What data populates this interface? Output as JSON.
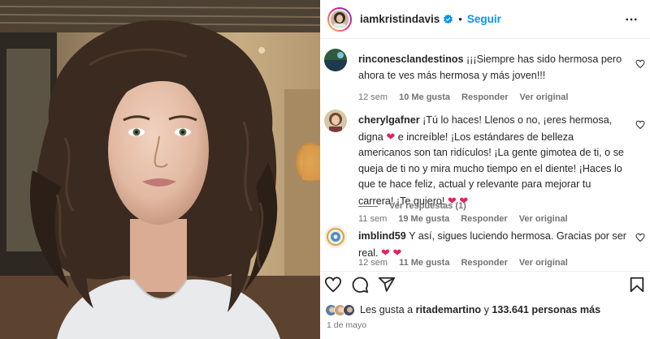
{
  "post": {
    "author": "iamkristindavis",
    "separator": "•",
    "follow_label": "Seguir",
    "date": "1 de mayo",
    "colors": {
      "accent": "#0095f6",
      "heart": "#e0245e",
      "muted": "#737373"
    }
  },
  "comments": [
    {
      "user": "rinconesclandestinos",
      "text": "¡¡¡Siempre has sido hermosa pero ahora te ves más hermosa y más joven!!!",
      "time": "12 sem",
      "likes": "10 Me gusta",
      "reply": "Responder",
      "translate": "Ver original"
    },
    {
      "user": "cherylgafner",
      "text_1": "¡Tú lo haces! Llenos o no, ¡eres hermosa, digna",
      "heart": "❤",
      "text_2": "e increíble! ¡Los estándares de belleza americanos son tan ridículos! ¡La gente gimotea de ti, o se queja de ti no y mira mucho tiempo en el diente! ¡Haces lo que te hace feliz, actual y relevante para mejorar tu carrera! ¡Te quiero!",
      "hearts_end": "❤ ❤",
      "time": "11 sem",
      "likes": "19 Me gusta",
      "reply": "Responder",
      "translate": "Ver original",
      "view_replies": "Ver respuestas (1)"
    },
    {
      "user": "imblind59",
      "text": "Y así, sigues luciendo hermosa. Gracias por ser real.",
      "hearts_end": "❤ ❤",
      "time": "12 sem",
      "likes": "11 Me gusta",
      "reply": "Responder",
      "translate": "Ver original"
    }
  ],
  "likes": {
    "prefix": "Les gusta a",
    "user": "ritademartino",
    "middle": "y",
    "count": "133.641 personas más"
  },
  "icons": [
    "verified-badge-icon",
    "more-options-icon",
    "heart-icon",
    "comment-icon",
    "share-icon",
    "bookmark-icon"
  ]
}
